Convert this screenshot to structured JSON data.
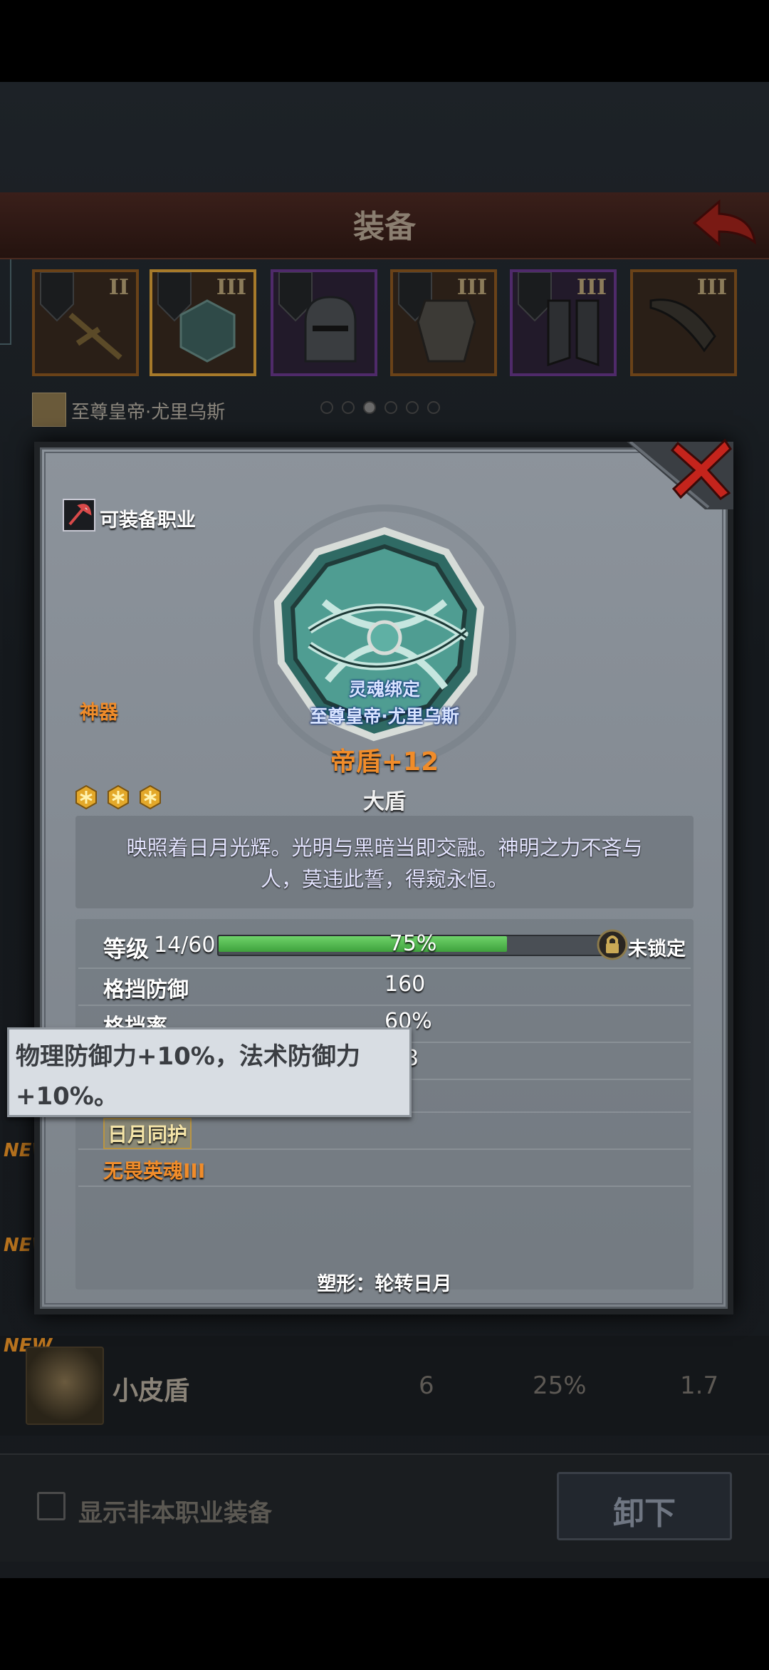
{
  "background": {
    "title": "装备",
    "slots": [
      {
        "tier": "II",
        "style": "orange"
      },
      {
        "tier": "III",
        "style": "selected"
      },
      {
        "tier": "",
        "style": "purple"
      },
      {
        "tier": "III",
        "style": "orange"
      },
      {
        "tier": "III",
        "style": "purple"
      },
      {
        "tier": "III",
        "style": "orange"
      }
    ],
    "owner_name": "至尊皇帝·尤里乌斯",
    "page_dots": 6,
    "active_page": 3,
    "new_badge": "NEW",
    "list_item": {
      "name": "小皮盾",
      "block_defense": "6",
      "block_rate": "25%",
      "value3": "1.7"
    },
    "show_other_class_label": "显示非本职业装备",
    "unequip_label": "卸下"
  },
  "modal": {
    "class_label": "可装备职业",
    "rarity": "神器",
    "soul_bound": "灵魂绑定",
    "soul_owner": "至尊皇帝·尤里乌斯",
    "item_name": "帝盾+12",
    "item_type": "大盾",
    "stars": 3,
    "description_line1": "映照着日月光辉。光明与黑暗当即交融。神明之力不吝与",
    "description_line2": "人，莫违此誓，得窥永恒。",
    "level_label": "等级",
    "level_value": "14/60",
    "xp_progress": 0.75,
    "xp_percent": "75%",
    "lock_label": "未锁定",
    "stats": [
      {
        "label": "格挡防御",
        "value": "160"
      },
      {
        "label": "格挡率",
        "value": "60%"
      },
      {
        "label": "",
        "value": "3.8"
      }
    ],
    "skills": [
      "日月同护",
      "无畏英魂III"
    ],
    "reshape": "塑形：轮转日月"
  },
  "tooltip": {
    "line1": "物理防御力+10%，法术防御力",
    "line2": "+10%。"
  },
  "colors": {
    "rarity_orange": "#f08c2a",
    "xp_green": "#4fbb4c",
    "soul_blue": "#d8e4ff"
  }
}
